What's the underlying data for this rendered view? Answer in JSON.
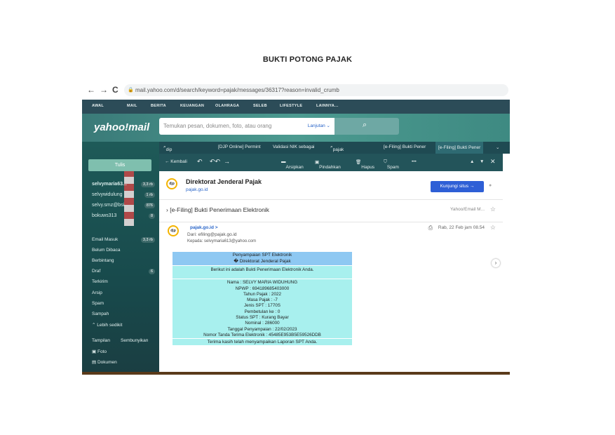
{
  "doc_title": "BUKTI POTONG PAJAK",
  "browser": {
    "back": "←",
    "forward": "→",
    "reload": "C",
    "url": "mail.yahoo.com/d/search/keyword=pajak/messages/36317?reason=invalid_crumb"
  },
  "topnav": [
    "AWAL",
    "MAIL",
    "BERITA",
    "KEUANGAN",
    "OLAHRAGA",
    "SELEB",
    "LIFESTYLE",
    "LAINNYA..."
  ],
  "header": {
    "logo": "yahoo!mail",
    "search_placeholder": "Temukan pesan, dokumen, foto, atau orang",
    "advanced": "Lanjutan ⌄"
  },
  "tabs": [
    "dip",
    "[DJP Online] Permint",
    "Validasi NIK sebagai",
    "pajak",
    "[e-Filing] Bukti Pener",
    "[e-Filing] Bukti Pener"
  ],
  "sidebar": {
    "compose": "Tulis",
    "accounts": [
      {
        "name": "selvymaria63...",
        "count": "3,3 rb"
      },
      {
        "name": "selvywidulung",
        "count": "1 rb"
      },
      {
        "name": "selvy.smz@bsi...",
        "count": "876"
      },
      {
        "name": "bokuws313",
        "count": "8"
      }
    ],
    "folders": [
      {
        "name": "Email Masuk",
        "count": "3,3 rb"
      },
      {
        "name": "Belum Dibaca",
        "count": ""
      },
      {
        "name": "Berbintang",
        "count": ""
      },
      {
        "name": "Draf",
        "count": "6"
      },
      {
        "name": "Terkirim",
        "count": ""
      },
      {
        "name": "Arsip",
        "count": ""
      },
      {
        "name": "Spam",
        "count": ""
      },
      {
        "name": "Sampah",
        "count": ""
      },
      {
        "name": "⌃ Lebih sedikit",
        "count": ""
      }
    ],
    "views_label": "Tampilan",
    "hide_label": "Sembunyikan",
    "views": [
      "Foto",
      "Dokumen"
    ]
  },
  "toolbar": {
    "back": "← Kembali",
    "archive": "Arsipkan",
    "move": "Pindahkan",
    "delete": "Hapus",
    "spam": "Spam",
    "more": "•••"
  },
  "sender": {
    "logo": "djp",
    "name": "Direktorat Jenderal Pajak",
    "url": "pajak.go.id",
    "visit": "Kunjungi situs →"
  },
  "subject": "[e-Filing] Bukti Penerimaan Elektronik",
  "subject_meta": "Yahoo/Email M...",
  "message": {
    "from_name": "pajak.go.id >",
    "from": "Dari: efiling@pajak.go.id",
    "to": "Kepada: selvymaria613@yahoo.com",
    "date": "Rab, 22 Feb jam 08.54"
  },
  "receipt": {
    "header_1": "Penyampaian SPT Elektronik",
    "header_2": "� Direktorat Jenderal Pajak",
    "intro": "Berikut ini adalah Bukti Penerimaan Elektronik Anda.",
    "lines": [
      "Nama : SELVY MARIA WIDUHUNG",
      "NPWP : 694189685403000",
      "Tahun Pajak : 2022",
      "Masa Pajak : -7",
      "Jenis SPT : 1770S",
      "Pembetulan ke : 0",
      "Status SPT : Kurang Bayar",
      "Nominal : 286000",
      "Tanggal Penyampaian : 22/02/2023",
      "Nomor Tanda Terima Elektronik : 45485E953B5E59526DDB"
    ],
    "footer": "Terima kasih telah menyampaikan Laporan SPT Anda."
  }
}
